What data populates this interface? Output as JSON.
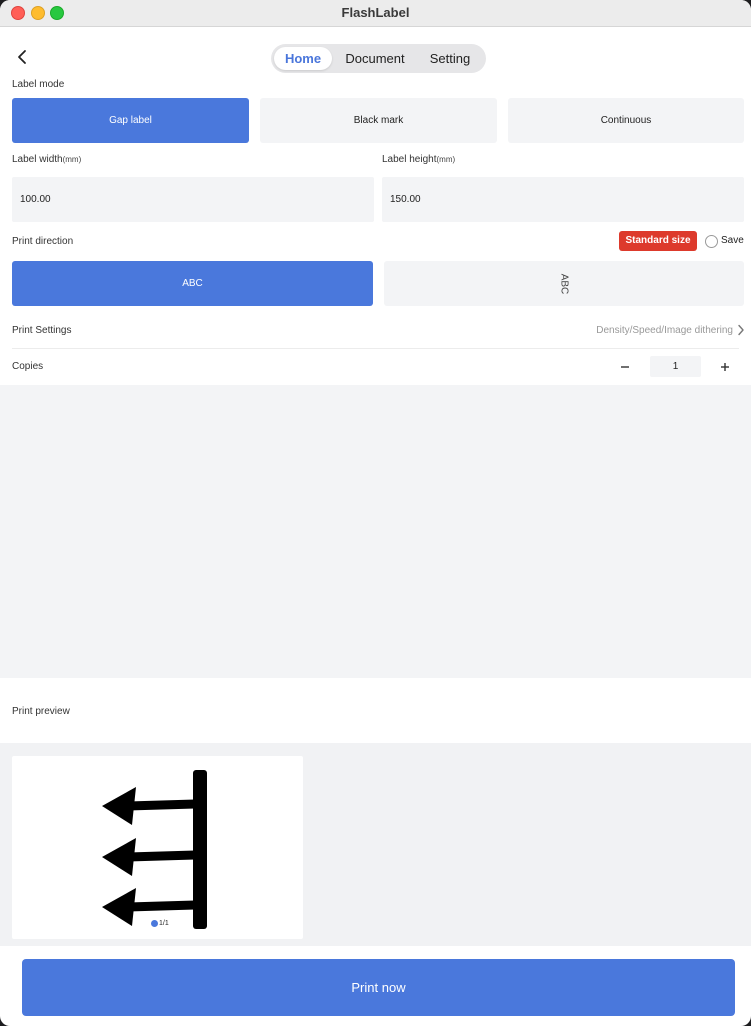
{
  "window": {
    "title": "FlashLabel"
  },
  "nav": {
    "tabs": [
      "Home",
      "Document",
      "Setting"
    ],
    "active_tab": "Home"
  },
  "label_mode": {
    "label": "Label mode",
    "options": [
      "Gap label",
      "Black mark",
      "Continuous"
    ],
    "selected": "Gap label"
  },
  "label_width": {
    "label": "Label width",
    "unit": "(mm)",
    "value": "100.00"
  },
  "label_height": {
    "label": "Label height",
    "unit": "(mm)",
    "value": "150.00"
  },
  "print_direction": {
    "label": "Print direction",
    "standard_size": "Standard size",
    "save_label": "Save",
    "save_checked": false,
    "horizontal_text": "ABC",
    "vertical_text": "ABC",
    "selected": "horizontal"
  },
  "print_settings": {
    "label": "Print Settings",
    "value": "Density/Speed/Image dithering"
  },
  "copies": {
    "label": "Copies",
    "value": "1"
  },
  "preview": {
    "label": "Print preview",
    "page_indicator": "1/1"
  },
  "actions": {
    "print_now": "Print now"
  },
  "colors": {
    "accent": "#4a78dc",
    "badge_red": "#dd3a2c",
    "panel_gray": "#f3f4f6"
  }
}
